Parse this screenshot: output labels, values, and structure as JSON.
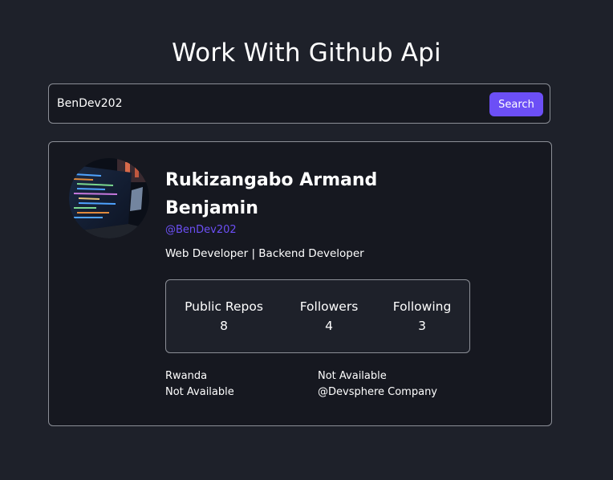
{
  "header": {
    "title": "Work With Github Api"
  },
  "search": {
    "value": "BenDev202",
    "button_label": "Search"
  },
  "profile": {
    "name": "Rukizangabo Armand Benjamin",
    "username": "@BenDev202",
    "bio": "Web Developer | Backend Developer",
    "stats": {
      "repos_label": "Public Repos",
      "repos_value": "8",
      "followers_label": "Followers",
      "followers_value": "4",
      "following_label": "Following",
      "following_value": "3"
    },
    "location": "Rwanda",
    "blog": "Not Available",
    "twitter": "Not Available",
    "company": "@Devsphere Company"
  },
  "colors": {
    "background": "#1e212a",
    "card": "#161820",
    "accent": "#6c4ff6",
    "border": "#8c8f97"
  }
}
